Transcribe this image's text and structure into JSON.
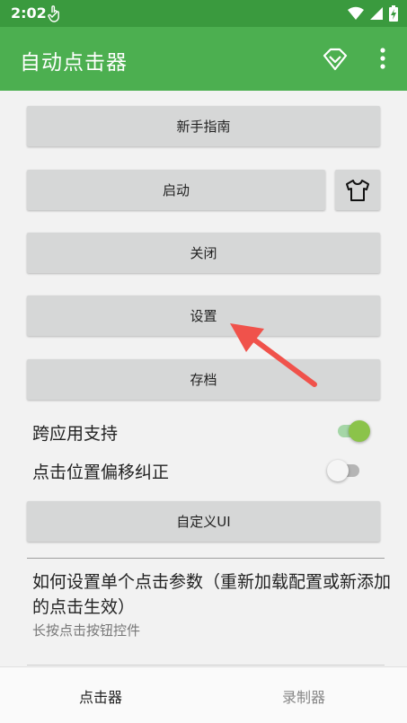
{
  "status": {
    "time": "2:02"
  },
  "app": {
    "title": "自动点击器"
  },
  "buttons": {
    "guide": "新手指南",
    "start": "启动",
    "close": "关闭",
    "settings": "设置",
    "archive": "存档",
    "custom_ui": "自定义UI"
  },
  "toggles": [
    {
      "label": "跨应用支持",
      "on": true
    },
    {
      "label": "点击位置偏移纠正",
      "on": false
    }
  ],
  "info": {
    "title": "如何设置单个点击参数（重新加载配置或新添加的点击生效）",
    "subtitle": "长按点击按钮控件"
  },
  "nav": {
    "clicker": "点击器",
    "recorder": "录制器"
  },
  "colors": {
    "primary": "#4caf50",
    "status_bar": "#3a9a3e",
    "switch_on": "#8bc34a",
    "arrow": "#f0524b"
  }
}
